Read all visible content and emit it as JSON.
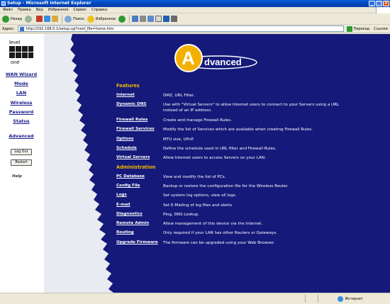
{
  "window": {
    "title": "Setup - Microsoft Internet Explorer",
    "controls": [
      "_",
      "□",
      "×"
    ]
  },
  "menu": [
    "Файл",
    "Правка",
    "Вид",
    "Избранное",
    "Сервис",
    "Справка"
  ],
  "toolbar": {
    "back": "Назад",
    "search": "Поиск",
    "favorites": "Избранное"
  },
  "address": {
    "label": "Адрес:",
    "url": "http://192.168.0.1/setup.cgi?next_file=home.htm",
    "go": "Переход",
    "links": "Ссылки"
  },
  "sidebar": {
    "logo": [
      "level",
      "one"
    ],
    "nav": [
      "WAN Wizard",
      "Mode",
      "LAN",
      "Wireless",
      "Password",
      "Status",
      "Advanced"
    ],
    "logout": "Log Out",
    "restart": "Restart",
    "help": "Help"
  },
  "banner": {
    "letter": "A",
    "rest": "dvanced"
  },
  "features": {
    "title": "Features",
    "items": [
      {
        "name": "Internet",
        "desc": "DMZ, URL Filter."
      },
      {
        "name": "Dynamic DNS",
        "desc": "Use with \"Virtual Servers\" to allow Internet users to connect to your Servers using a URL instead of an IP address."
      },
      {
        "name": "Firewall Rules",
        "desc": "Create and manage Firewall Rules."
      },
      {
        "name": "Firewall Services",
        "desc": "Modify the list of Services which are available when creating Firewall Rules."
      },
      {
        "name": "Options",
        "desc": "MTU size, UPnP."
      },
      {
        "name": "Schedule",
        "desc": "Define the schedule used in URL filter and Firewall Rules."
      },
      {
        "name": "Virtual Servers",
        "desc": "Allow Internet users to access Servers on your LAN."
      }
    ]
  },
  "administration": {
    "title": "Administration",
    "items": [
      {
        "name": "PC Database",
        "desc": "View and modify the list of PCs."
      },
      {
        "name": "Config File",
        "desc": "Backup or restore the configuration file for the Wireless Router."
      },
      {
        "name": "Logs",
        "desc": "Set system log options, view all logs."
      },
      {
        "name": "E-mail",
        "desc": "Set E-Mailing of log files and alerts"
      },
      {
        "name": "Diagnostics",
        "desc": "Ping, DNS Lookup."
      },
      {
        "name": "Remote Admin",
        "desc": "Allow management of this device via the Internet."
      },
      {
        "name": "Routing",
        "desc": "Only required if your LAN has other Routers or Gateways."
      },
      {
        "name": "Upgrade Firmware",
        "desc": "The firmware can be upgraded using your Web Browser."
      }
    ]
  },
  "status": {
    "zone": "Интернет"
  },
  "colors": {
    "page_bg": "#15197a",
    "nav_text": "#1b1f8a",
    "section_title": "#f2b400",
    "banner_yellow": "#f4b000"
  }
}
